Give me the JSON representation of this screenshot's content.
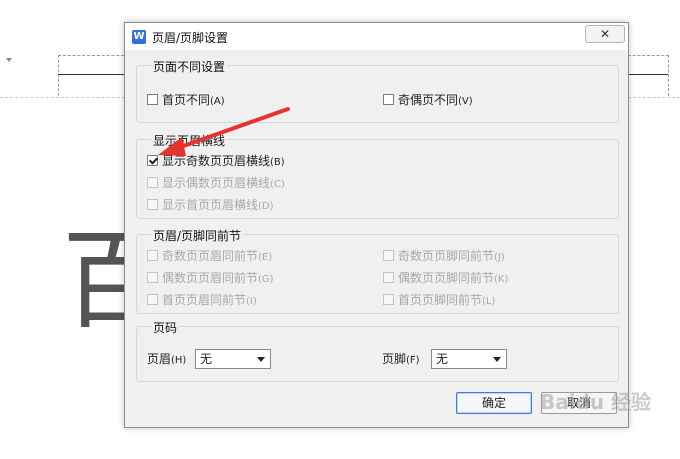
{
  "dialog": {
    "title": "页眉/页脚设置",
    "app_icon": "wps-writer-icon",
    "close_label": "✕"
  },
  "sections": {
    "different": {
      "title": "页面不同设置",
      "first_page": {
        "label": "首页不同",
        "key": "(A)",
        "checked": false
      },
      "odd_even": {
        "label": "奇偶页不同",
        "key": "(V)",
        "checked": false
      }
    },
    "header_line": {
      "title": "显示页眉横线",
      "odd": {
        "label": "显示奇数页页眉横线",
        "key": "(B)",
        "checked": true
      },
      "even": {
        "label": "显示偶数页页眉横线",
        "key": "(C)",
        "checked": false
      },
      "first": {
        "label": "显示首页页眉横线",
        "key": "(D)",
        "checked": false
      }
    },
    "same_as_prev": {
      "title": "页眉/页脚同前节",
      "odd_header": {
        "label": "奇数页页眉同前节",
        "key": "(E)"
      },
      "even_header": {
        "label": "偶数页页眉同前节",
        "key": "(G)"
      },
      "first_header": {
        "label": "首页页眉同前节",
        "key": "(I)"
      },
      "odd_footer": {
        "label": "奇数页页脚同前节",
        "key": "(J)"
      },
      "even_footer": {
        "label": "偶数页页脚同前节",
        "key": "(K)"
      },
      "first_footer": {
        "label": "首页页脚同前节",
        "key": "(L)"
      }
    },
    "page_number": {
      "title": "页码",
      "header_label": "页眉",
      "header_key": "(H)",
      "header_value": "无",
      "footer_label": "页脚",
      "footer_key": "(F)",
      "footer_value": "无"
    }
  },
  "buttons": {
    "ok": "确定",
    "cancel": "取消"
  },
  "document": {
    "big_char": "百"
  },
  "annotation": {
    "arrow_color": "#e8322c"
  },
  "watermark": "Baidu 经验"
}
